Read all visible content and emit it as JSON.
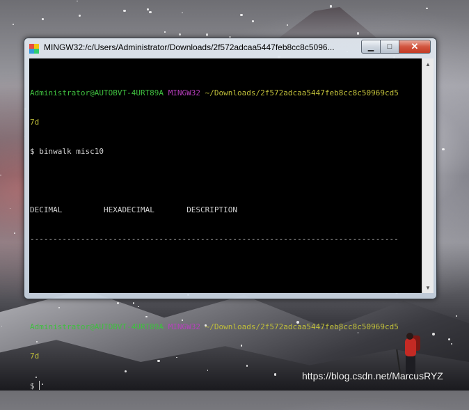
{
  "window": {
    "title": "MINGW32:/c/Users/Administrator/Downloads/2f572adcaa5447feb8cc8c5096...",
    "buttons": {
      "minimize": "▁",
      "maximize": "□",
      "close": "✕"
    }
  },
  "terminal": {
    "prompt1": {
      "user": "Administrator@AUTOBVT-4URT89A",
      "env": "MINGW32",
      "path_line1": "~/Downloads/2f572adcaa5447feb8cc8c50969cd5",
      "path_line2": "7d"
    },
    "command1": "$ binwalk misc10",
    "headers": {
      "c1": "DECIMAL",
      "c2": "HEXADECIMAL",
      "c3": "DESCRIPTION"
    },
    "separator": "--------------------------------------------------------------------------------",
    "prompt2": {
      "user": "Administrator@AUTOBVT-4URT89A",
      "env": "MINGW32",
      "path_line1": "~/Downloads/2f572adcaa5447feb8cc8c50969cd5",
      "path_line2": "7d"
    },
    "prompt_symbol": "$ "
  },
  "watermark": "https://blog.csdn.net/MarcusRYZ",
  "icons": [
    "mingw-app-icon",
    "minimize-icon",
    "maximize-icon",
    "close-icon",
    "scroll-up-icon",
    "scroll-down-icon"
  ],
  "colors": {
    "user": "#3fbf3f",
    "env": "#b93fbf",
    "path": "#c0bf3a",
    "text": "#d0d0d0",
    "background": "#000000"
  }
}
